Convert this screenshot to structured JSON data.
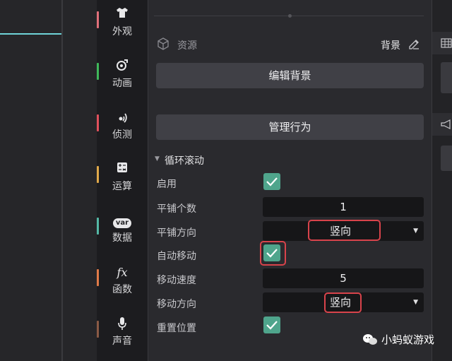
{
  "categories": [
    {
      "label": "外观",
      "icon": "shirt-icon",
      "color": "#e0707a"
    },
    {
      "label": "动画",
      "icon": "animation-icon",
      "color": "#3fb85a"
    },
    {
      "label": "侦测",
      "icon": "radar-icon",
      "color": "#e0505c"
    },
    {
      "label": "运算",
      "icon": "calculator-icon",
      "color": "#e0a94a"
    },
    {
      "label": "数据",
      "icon": "var-icon",
      "color": "#54b8a6",
      "icon_text": "var"
    },
    {
      "label": "函数",
      "icon": "function-icon",
      "color": "#e07a48",
      "icon_text": "fx"
    },
    {
      "label": "声音",
      "icon": "microphone-icon",
      "color": "#8a5a45"
    }
  ],
  "resource": {
    "label": "资源",
    "background_label": "背景"
  },
  "buttons": {
    "edit_background": "编辑背景",
    "manage_behavior": "管理行为"
  },
  "section": {
    "title": "循环滚动"
  },
  "properties": {
    "enabled": {
      "label": "启用",
      "checked": true
    },
    "tile_count": {
      "label": "平铺个数",
      "value": "1"
    },
    "tile_direction": {
      "label": "平铺方向",
      "value": "竖向"
    },
    "auto_move": {
      "label": "自动移动",
      "checked": true
    },
    "move_speed": {
      "label": "移动速度",
      "value": "5"
    },
    "move_direction": {
      "label": "移动方向",
      "value": "竖向"
    },
    "reset_position": {
      "label": "重置位置",
      "checked": true
    }
  },
  "watermark": {
    "text": "小蚂蚁游戏",
    "icon": "wechat-icon"
  },
  "colors": {
    "accent_check": "#4fa58c",
    "highlight": "#d8434b"
  }
}
